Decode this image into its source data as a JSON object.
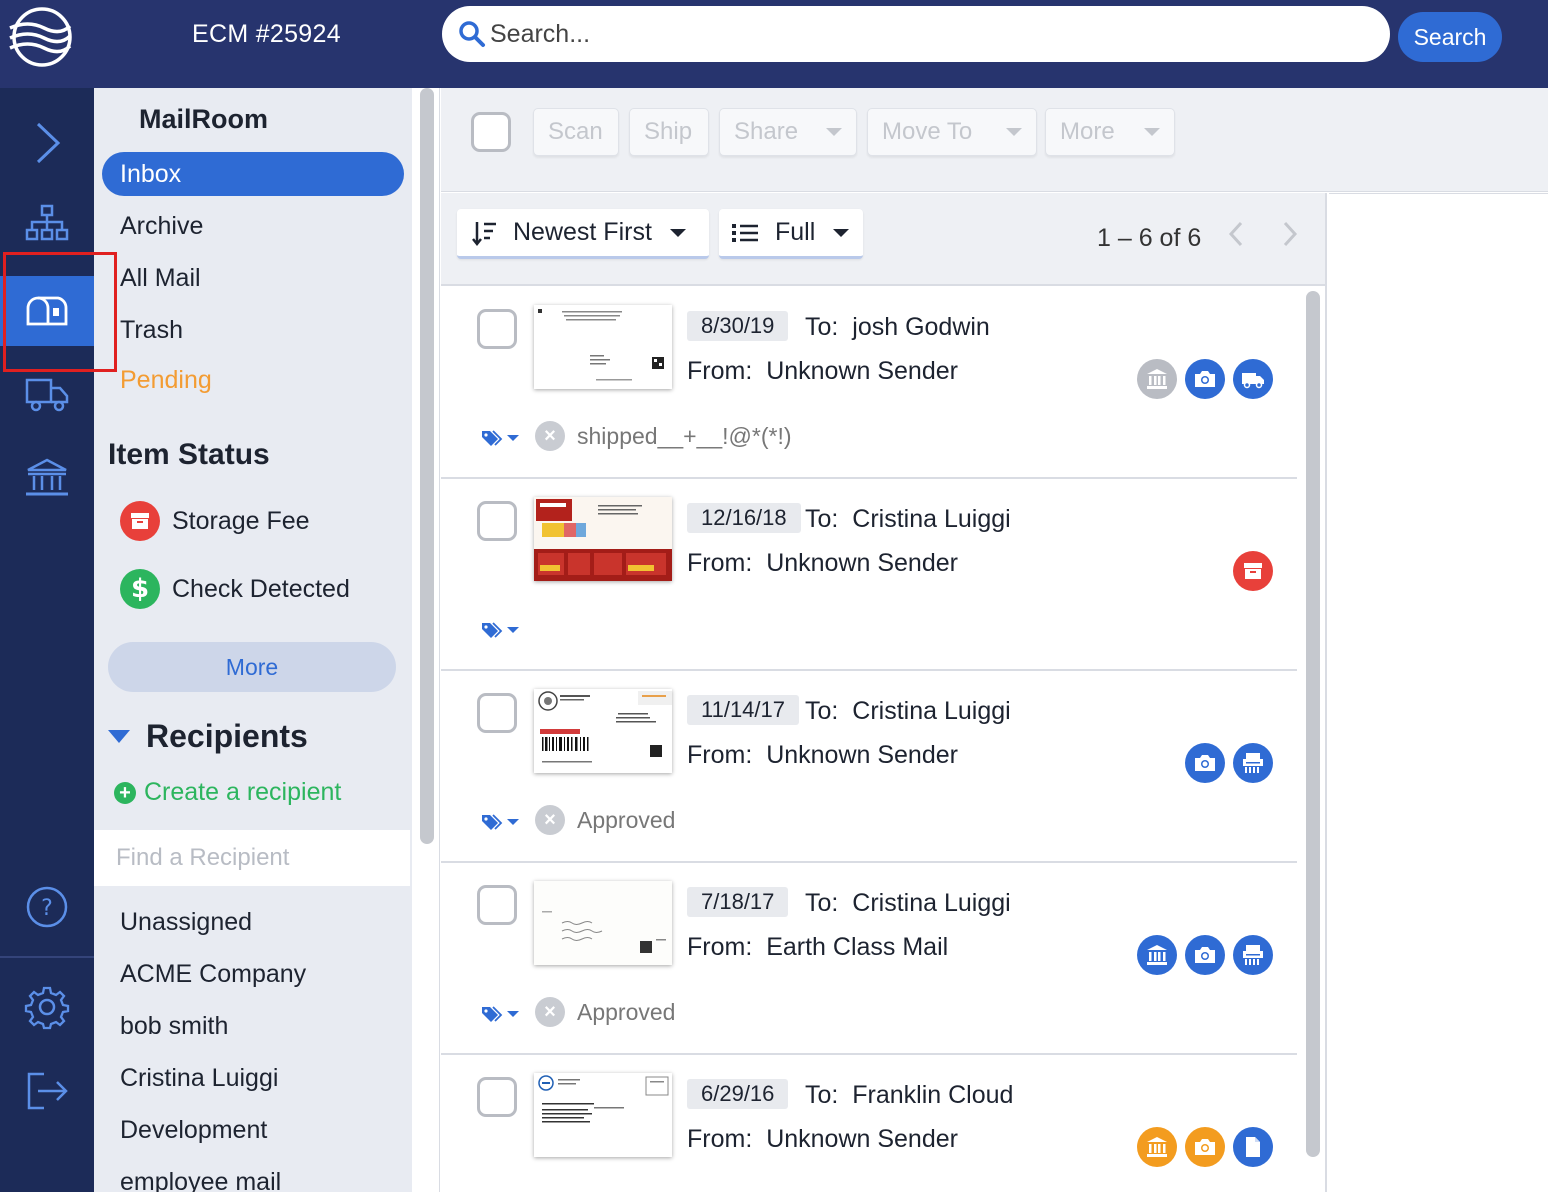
{
  "header": {
    "account": "ECM #25924",
    "search_placeholder": "Search...",
    "search_button": "Search"
  },
  "sidebar": {
    "title": "MailRoom",
    "folders": [
      {
        "label": "Inbox"
      },
      {
        "label": "Archive"
      },
      {
        "label": "All Mail"
      },
      {
        "label": "Trash"
      },
      {
        "label": "Pending"
      }
    ],
    "item_status_title": "Item Status",
    "statuses": [
      {
        "label": "Storage Fee",
        "color": "#e8403a",
        "icon": "archive-box-icon"
      },
      {
        "label": "Check Detected",
        "color": "#2cb55e",
        "icon": "dollar-icon"
      }
    ],
    "more_label": "More",
    "recipients_title": "Recipients",
    "create_recipient": "Create a recipient",
    "find_placeholder": "Find a Recipient",
    "recipients": [
      "Unassigned",
      "ACME Company",
      "bob smith",
      "Cristina Luiggi",
      "Development",
      "employee mail"
    ]
  },
  "toolbar": {
    "scan": "Scan",
    "ship": "Ship",
    "share": "Share",
    "move_to": "Move To",
    "more": "More"
  },
  "sort": {
    "order": "Newest First",
    "view": "Full",
    "pager": "1 – 6 of 6"
  },
  "labels": {
    "to": "To:",
    "from": "From:"
  },
  "mail_items": [
    {
      "date": "8/30/19",
      "to": "josh Godwin",
      "from": "Unknown Sender",
      "tag": "shipped__+__!@*(*!)"
    },
    {
      "date": "12/16/18",
      "to": "Cristina Luiggi",
      "from": "Unknown Sender",
      "tag": ""
    },
    {
      "date": "11/14/17",
      "to": "Cristina Luiggi",
      "from": "Unknown Sender",
      "tag": "Approved"
    },
    {
      "date": "7/18/17",
      "to": "Cristina Luiggi",
      "from": "Earth Class Mail",
      "tag": "Approved"
    },
    {
      "date": "6/29/16",
      "to": "Franklin Cloud",
      "from": "Unknown Sender",
      "tag": ""
    }
  ],
  "colors": {
    "header_bg": "#27346e",
    "rail_bg": "#1c2b58",
    "accent": "#2f6bd4",
    "pending": "#f39c33",
    "green": "#2cb55e",
    "red": "#e8403a",
    "orange": "#f39c1f",
    "gray_icon": "#b9bcc3"
  }
}
